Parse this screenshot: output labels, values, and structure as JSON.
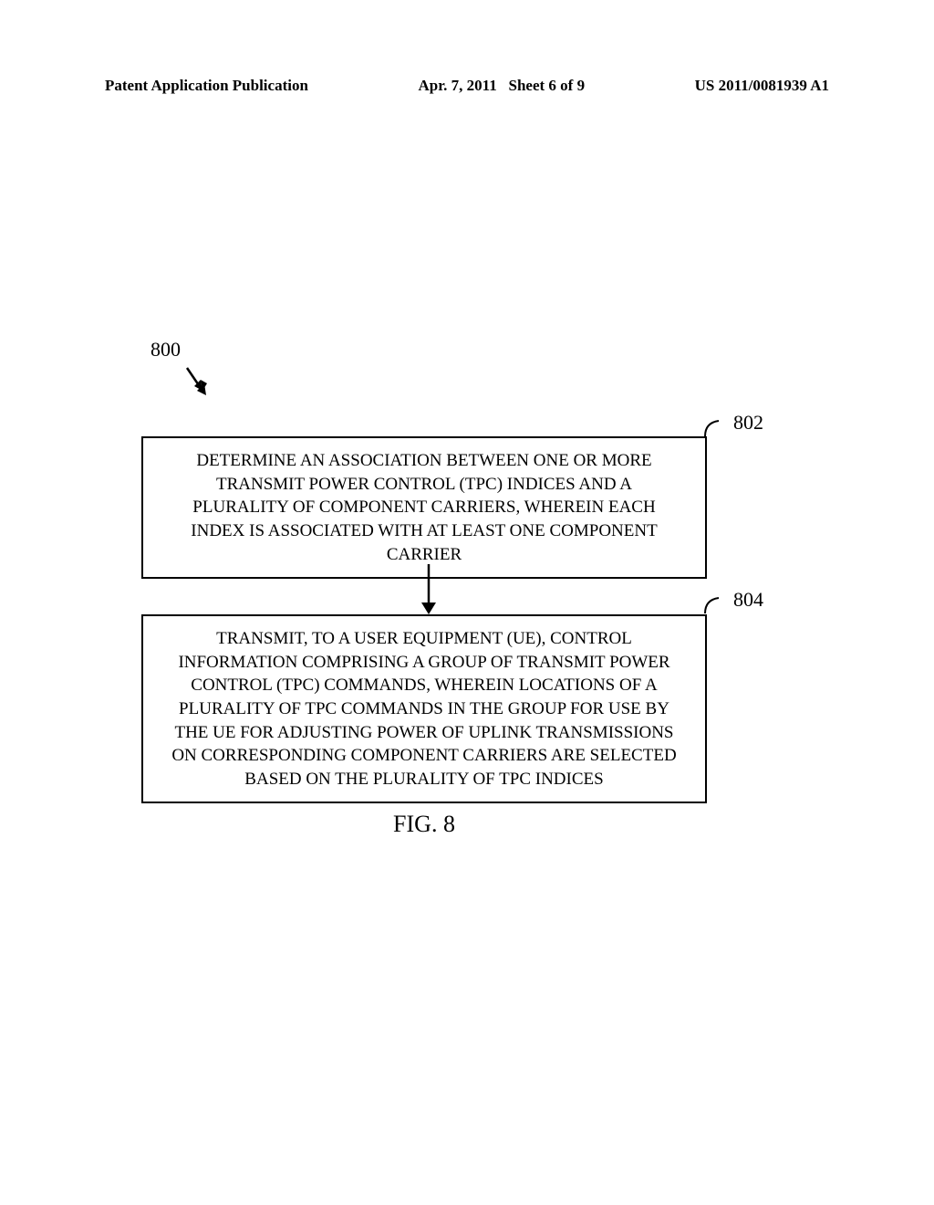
{
  "header": {
    "left": "Patent Application Publication",
    "center_date": "Apr. 7, 2011",
    "center_sheet": "Sheet 6 of 9",
    "right": "US 2011/0081939 A1"
  },
  "diagram": {
    "ref_main": "800",
    "ref_step1": "802",
    "ref_step2": "804",
    "step1_text": "DETERMINE AN ASSOCIATION BETWEEN ONE OR MORE TRANSMIT POWER CONTROL (TPC) INDICES AND A PLURALITY OF COMPONENT CARRIERS, WHEREIN EACH INDEX IS ASSOCIATED WITH AT LEAST ONE COMPONENT CARRIER",
    "step2_text": "TRANSMIT, TO A USER EQUIPMENT (UE), CONTROL INFORMATION COMPRISING A GROUP OF TRANSMIT POWER CONTROL (TPC) COMMANDS, WHEREIN LOCATIONS OF A PLURALITY OF TPC COMMANDS IN THE GROUP FOR USE BY THE UE FOR ADJUSTING POWER OF UPLINK TRANSMISSIONS ON CORRESPONDING COMPONENT CARRIERS ARE SELECTED BASED ON THE PLURALITY OF TPC INDICES",
    "figure_label": "FIG. 8"
  }
}
